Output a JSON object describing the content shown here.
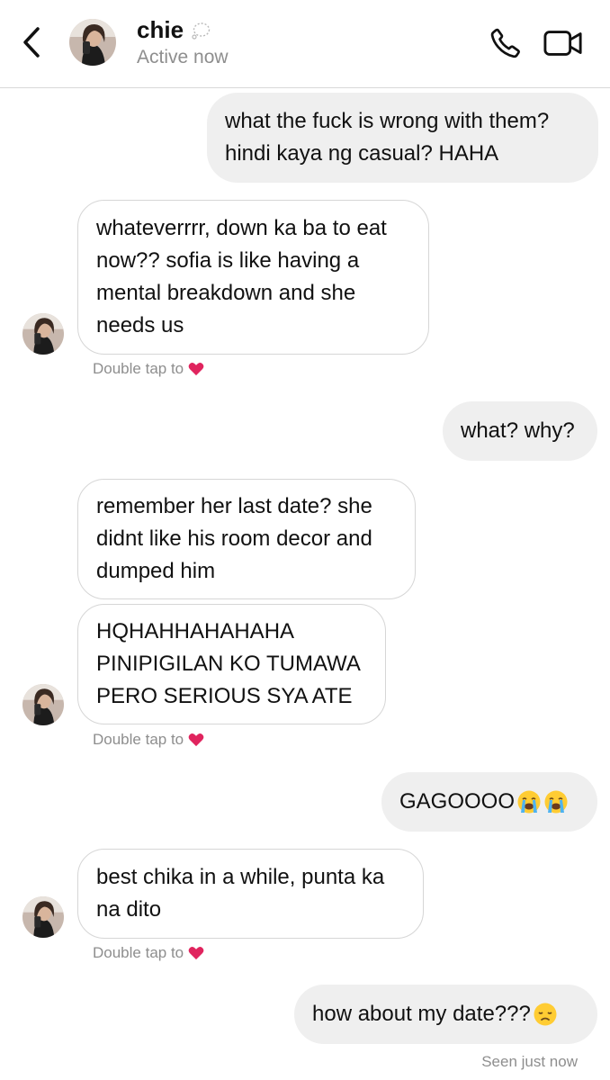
{
  "header": {
    "contact_name": "chie",
    "status": "Active now",
    "back_icon": "chevron-left-icon",
    "phone_icon": "phone-icon",
    "video_icon": "video-camera-icon"
  },
  "messages": [
    {
      "side": "out",
      "text": "what the fuck is wrong with them?\nhindi kaya ng casual? HAHA"
    },
    {
      "side": "in",
      "text": "whateverrrr, down ka ba to eat\nnow?? sofia is like having a\nmental breakdown and she\nneeds us"
    },
    {
      "side": "out",
      "text": "what? why?"
    },
    {
      "side": "in",
      "text": "remember her last date? she\ndidnt like his room decor and\ndumped him"
    },
    {
      "side": "in",
      "text": "HQHAHHAHAHAHA\nPINIPIGILAN KO TUMAWA\nPERO SERIOUS SYA ATE"
    },
    {
      "side": "out",
      "text": "GAGOOOO"
    },
    {
      "side": "in",
      "text": "best chika in a while, punta ka\nna dito"
    },
    {
      "side": "out",
      "text": "how about my date???"
    }
  ],
  "reaction_hint": "Double tap to",
  "seen_status": "Seen just now",
  "colors": {
    "outgoing_bubble": "#efefef",
    "incoming_border": "#d6d6d6",
    "secondary_text": "#8e8e8e",
    "heart": "#e0245e"
  }
}
